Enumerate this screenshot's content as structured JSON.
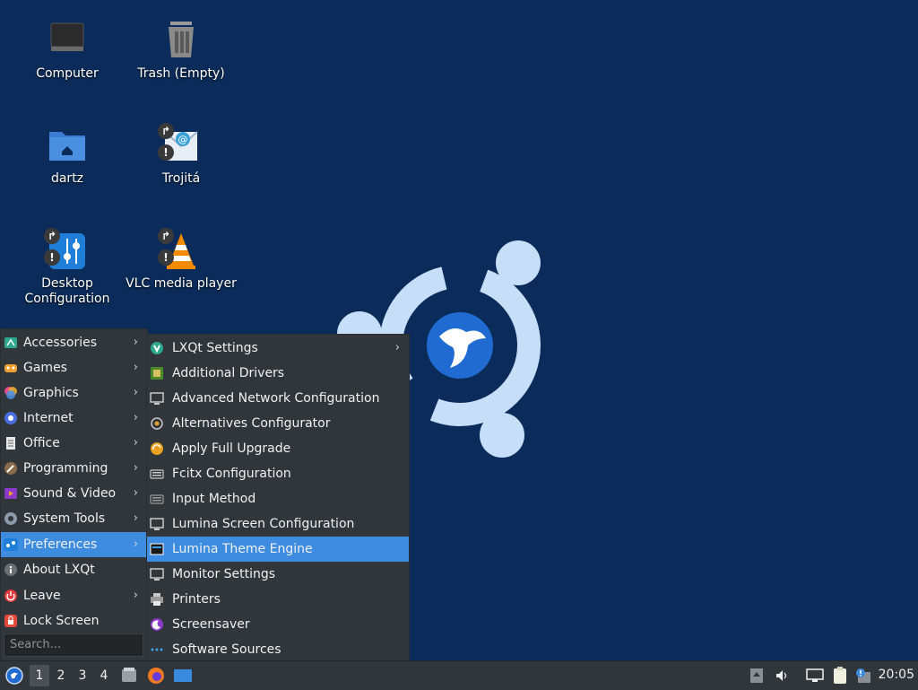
{
  "desktop": {
    "icons": [
      {
        "label": "Computer"
      },
      {
        "label": "Trash (Empty)"
      },
      {
        "label": "dartz"
      },
      {
        "label": "Trojitá"
      },
      {
        "label": "Desktop Configuration"
      },
      {
        "label": "VLC media player"
      }
    ]
  },
  "main_menu": {
    "items": [
      {
        "label": "Accessories",
        "icon": "accessories-icon",
        "submenu": true
      },
      {
        "label": "Games",
        "icon": "games-icon",
        "submenu": true
      },
      {
        "label": "Graphics",
        "icon": "graphics-icon",
        "submenu": true
      },
      {
        "label": "Internet",
        "icon": "internet-icon",
        "submenu": true
      },
      {
        "label": "Office",
        "icon": "office-icon",
        "submenu": true
      },
      {
        "label": "Programming",
        "icon": "programming-icon",
        "submenu": true
      },
      {
        "label": "Sound & Video",
        "icon": "sound-video-icon",
        "submenu": true
      },
      {
        "label": "System Tools",
        "icon": "system-tools-icon",
        "submenu": true
      },
      {
        "label": "Preferences",
        "icon": "preferences-icon",
        "submenu": true,
        "highlighted": true
      },
      {
        "label": "About LXQt",
        "icon": "info-icon",
        "submenu": false
      },
      {
        "label": "Leave",
        "icon": "power-icon",
        "submenu": true
      },
      {
        "label": "Lock Screen",
        "icon": "lock-icon",
        "submenu": false
      }
    ],
    "search_placeholder": "Search..."
  },
  "preferences_menu": {
    "items": [
      {
        "label": "LXQt Settings",
        "icon": "lxqt-settings-icon",
        "submenu": true
      },
      {
        "label": "Additional Drivers",
        "icon": "chip-icon"
      },
      {
        "label": "Advanced Network Configuration",
        "icon": "network-icon"
      },
      {
        "label": "Alternatives Configurator",
        "icon": "alternatives-icon"
      },
      {
        "label": "Apply Full Upgrade",
        "icon": "upgrade-icon"
      },
      {
        "label": "Fcitx Configuration",
        "icon": "keyboard-icon"
      },
      {
        "label": "Input Method",
        "icon": "keyboard-icon"
      },
      {
        "label": "Lumina Screen Configuration",
        "icon": "monitor-icon"
      },
      {
        "label": "Lumina Theme Engine",
        "icon": "theme-icon",
        "highlighted": true
      },
      {
        "label": "Monitor Settings",
        "icon": "monitor-icon"
      },
      {
        "label": "Printers",
        "icon": "printer-icon"
      },
      {
        "label": "Screensaver",
        "icon": "screensaver-icon"
      },
      {
        "label": "Software Sources",
        "icon": "software-sources-icon"
      }
    ]
  },
  "taskbar": {
    "workspaces": [
      "1",
      "2",
      "3",
      "4"
    ],
    "active_workspace": "1",
    "clock": "20:05"
  },
  "colors": {
    "desktop_bg": "#0b2c5a",
    "menu_bg": "#31363b",
    "highlight": "#3d8ce0",
    "logo_light": "#c6def7",
    "logo_blue": "#1f6bd1"
  }
}
